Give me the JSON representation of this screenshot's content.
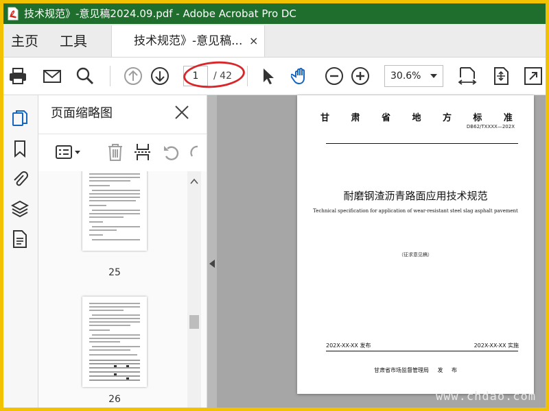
{
  "window": {
    "title": "技术规范》-意见稿2024.09.pdf - Adobe Acrobat Pro DC"
  },
  "nav": {
    "home_label": "主页",
    "tools_label": "工具"
  },
  "tab": {
    "label": "技术规范》-意见稿...",
    "close_glyph": "×"
  },
  "toolbar": {
    "page_current": "1",
    "page_total": "/ 42",
    "zoom_value": "30.6%"
  },
  "panel": {
    "title": "页面缩略图",
    "thumbnails": [
      {
        "label": "25"
      },
      {
        "label": "26"
      }
    ]
  },
  "page": {
    "header_chars": [
      "甘",
      "肃",
      "省",
      "地",
      "方",
      "标",
      "准"
    ],
    "code": "DB62/TXXXX—202X",
    "title": "耐磨钢渣沥青路面应用技术规范",
    "subtitle": "Technical specification for application of wear-resistant steel slag asphalt pavement",
    "draft_note": "（征求意见稿）",
    "release_date": "202X-XX-XX 发布",
    "implement_date": "202X-XX-XX 实施",
    "issuer": "甘肃省市场监督管理局 发 布"
  },
  "watermark": {
    "site": "www.chdao.com"
  },
  "colors": {
    "titlebar_bg": "#1f6e2e",
    "frame_border": "#f2c200",
    "accent_blue": "#1565c0",
    "highlight_red": "#d8262a",
    "doc_bg": "#a6a6a6"
  }
}
